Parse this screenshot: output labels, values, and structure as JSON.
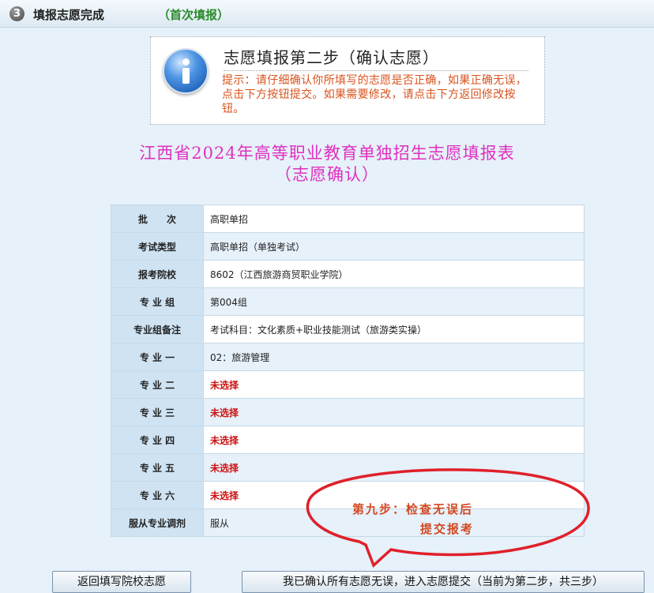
{
  "header": {
    "step_number": "3",
    "title": "填报志愿完成",
    "subtitle": "（首次填报）"
  },
  "notice": {
    "icon": "info-icon",
    "title": "志愿填报第二步（确认志愿）",
    "text": "提示：请仔细确认你所填写的志愿是否正确，如果正确无误，点击下方按钮提交。如果需要修改，请点击下方返回修改按钮。"
  },
  "form_title": {
    "line1": "江西省2024年高等职业教育单独招生志愿填报表",
    "line2": "（志愿确认）"
  },
  "rows": [
    {
      "label": "批　　次",
      "value": "高职单招",
      "status": "normal"
    },
    {
      "label": "考试类型",
      "value": "高职单招（单独考试）",
      "status": "normal"
    },
    {
      "label": "报考院校",
      "value": "8602（江西旅游商贸职业学院）",
      "status": "normal"
    },
    {
      "label": "专 业 组",
      "value": "第004组",
      "status": "normal"
    },
    {
      "label": "专业组备注",
      "value": "考试科目：文化素质+职业技能测试（旅游类实操）",
      "status": "normal"
    },
    {
      "label": "专 业 一",
      "value": "02：旅游管理",
      "status": "normal"
    },
    {
      "label": "专 业 二",
      "value": "未选择",
      "status": "unselected"
    },
    {
      "label": "专 业 三",
      "value": "未选择",
      "status": "unselected"
    },
    {
      "label": "专 业 四",
      "value": "未选择",
      "status": "unselected"
    },
    {
      "label": "专 业 五",
      "value": "未选择",
      "status": "unselected"
    },
    {
      "label": "专 业 六",
      "value": "未选择",
      "status": "unselected"
    },
    {
      "label": "服从专业调剂",
      "value": "服从",
      "status": "normal"
    }
  ],
  "annotation": {
    "line1": "第九步：检查无误后",
    "line2": "提交报考"
  },
  "buttons": {
    "back": "返回填写院校志愿",
    "confirm": "我已确认所有志愿无误，进入志愿提交（当前为第二步，共三步）"
  },
  "colors": {
    "notice_text": "#d9531e",
    "form_title": "#e030c0",
    "unselected": "#cc1111",
    "annotation": "#e0202a"
  }
}
